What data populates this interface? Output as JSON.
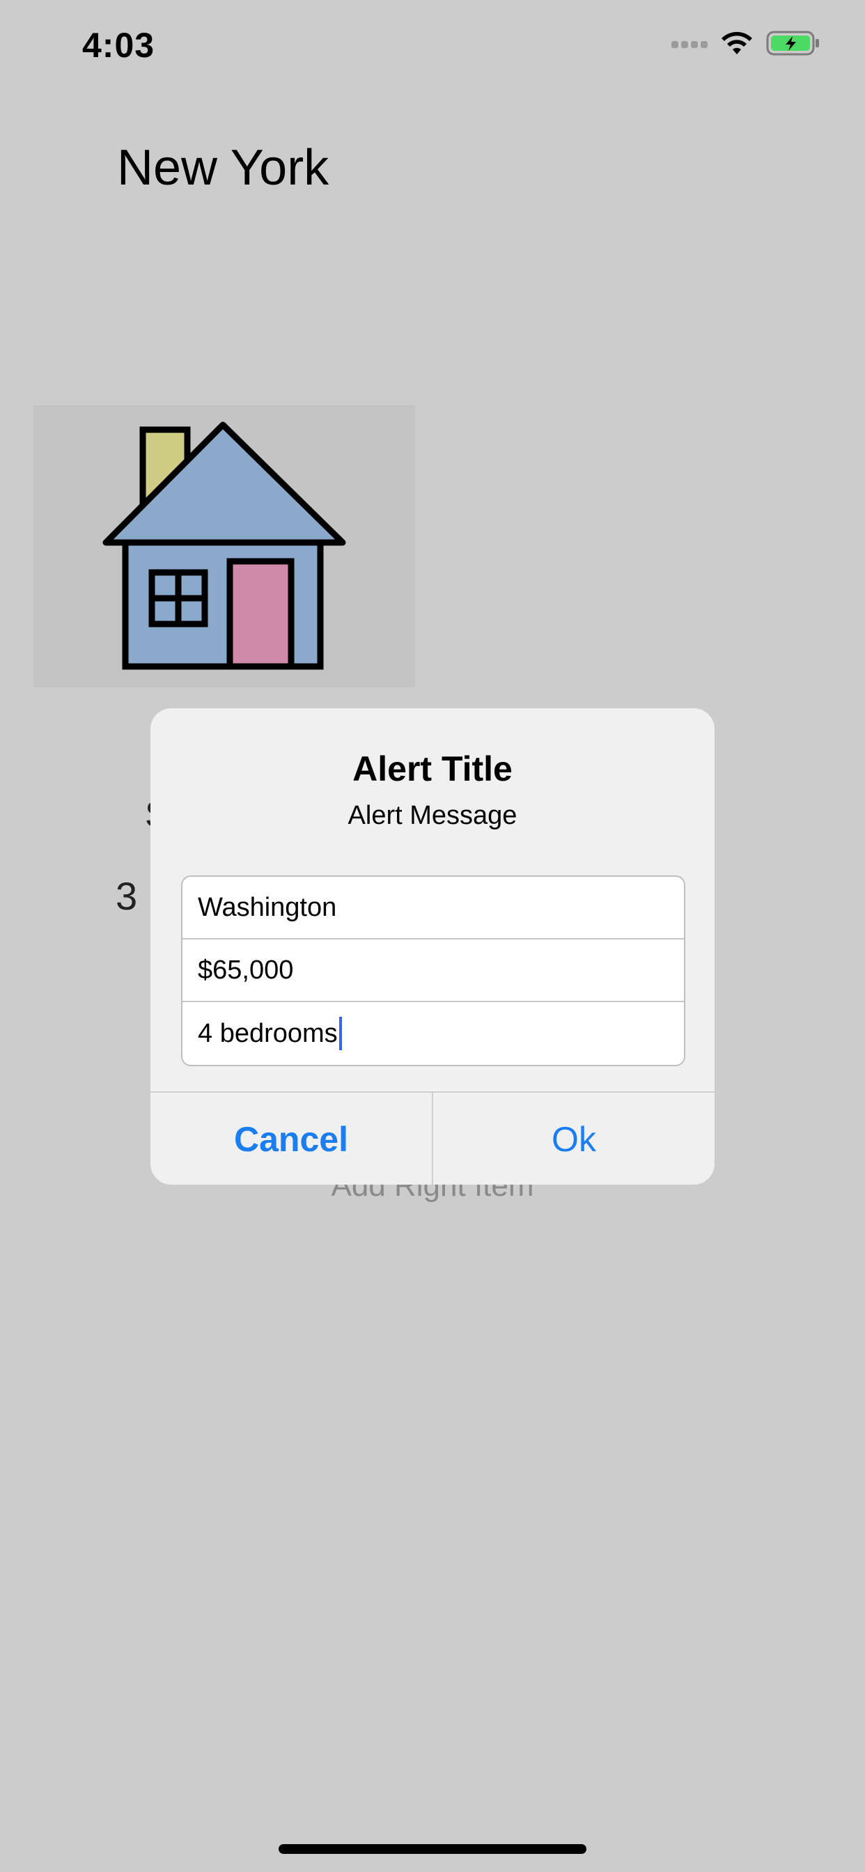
{
  "status_bar": {
    "time": "4:03",
    "icons": [
      "signal-icon",
      "wifi-icon",
      "battery-charging-icon"
    ],
    "battery_color": "#4cd964"
  },
  "screen": {
    "city_title": "New York",
    "image": "house-icon",
    "partial_label": "S",
    "partial_number": "3",
    "add_right_item": "Add Right Item"
  },
  "alert": {
    "title": "Alert Title",
    "message": "Alert Message",
    "fields": [
      {
        "value": "Washington"
      },
      {
        "value": "$65,000"
      },
      {
        "value": "4 bedrooms"
      }
    ],
    "cancel_label": "Cancel",
    "ok_label": "Ok",
    "accent_color": "#1a7ef0"
  }
}
